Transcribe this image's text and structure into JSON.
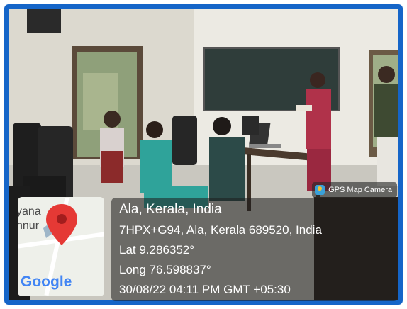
{
  "overlay": {
    "app_label": "GPS Map Camera",
    "place": "Ala, Kerala, India",
    "address": "7HPX+G94, Ala, Kerala 689520, India",
    "latitude": "Lat 9.286352°",
    "longitude": "Long 76.598837°",
    "datetime": "30/08/22 04:11 PM GMT +05:30"
  },
  "map": {
    "place_fragment_1": "yana",
    "place_fragment_2": "nnur",
    "logo_text": "Google",
    "pin_color": "#e53935",
    "icon": "map-pin-icon"
  },
  "colors": {
    "frame": "#1565c8",
    "wall": "#e6e4dc",
    "blackboard": "#2f3d3a"
  }
}
